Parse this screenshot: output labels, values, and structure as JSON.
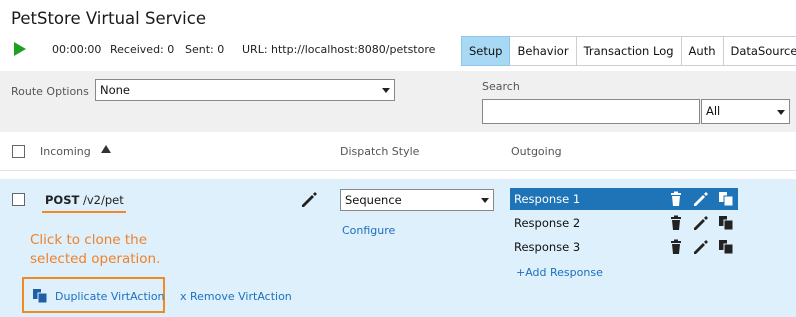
{
  "window": {
    "title": "PetStore Virtual Service"
  },
  "toolbar": {
    "time": "00:00:00",
    "received": "Received: 0",
    "sent": "Sent: 0",
    "url": "URL: http://localhost:8080/petstore",
    "play_icon": "play-icon"
  },
  "tabs": [
    {
      "label": "Setup",
      "active": true
    },
    {
      "label": "Behavior",
      "active": false
    },
    {
      "label": "Transaction Log",
      "active": false
    },
    {
      "label": "Auth",
      "active": false
    },
    {
      "label": "DataSources",
      "active": false
    }
  ],
  "filters": {
    "route_options_label": "Route Options",
    "route_options_value": "None",
    "search_label": "Search",
    "search_value": "",
    "search_scope_value": "All"
  },
  "columns": {
    "incoming": "Incoming",
    "dispatch_style": "Dispatch Style",
    "outgoing": "Outgoing"
  },
  "operation": {
    "method": "POST",
    "path": "/v2/pet",
    "dispatch_value": "Sequence",
    "configure_label": "Configure",
    "responses": [
      {
        "label": "Response 1",
        "selected": true
      },
      {
        "label": "Response 2",
        "selected": false
      },
      {
        "label": "Response 3",
        "selected": false
      }
    ],
    "add_response_label": "+Add Response",
    "duplicate_label": "Duplicate VirtAction",
    "remove_label": "x Remove VirtAction"
  },
  "hint": {
    "line1": "Click to clone the",
    "line2": "selected operation."
  },
  "colors": {
    "accent": "#1f73b7",
    "active_tab": "#a7d9f4",
    "row_bg": "#ddf0fb",
    "callout": "#f0812a",
    "play": "#20a020"
  }
}
